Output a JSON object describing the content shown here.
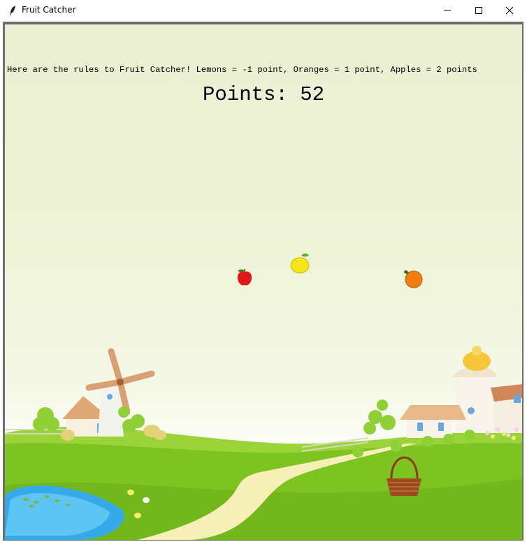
{
  "window": {
    "title": "Fruit Catcher",
    "app_icon": "feather-icon",
    "controls": [
      "minimize-icon",
      "maximize-icon",
      "close-icon"
    ]
  },
  "game": {
    "rules_text": "Here are the rules to Fruit Catcher! Lemons = -1 point, Oranges = 1 point, Apples = 2 points",
    "points_label": "Points: 52",
    "points": 52,
    "fruits": [
      "apple",
      "lemon",
      "orange"
    ],
    "catcher": "basket-icon",
    "colors": {
      "sky": "#ebefd2",
      "grass": "#7dc422",
      "apple": "#e01818",
      "lemon": "#f5e51c",
      "orange": "#f07d10",
      "basket": "#9a4b1f"
    }
  }
}
